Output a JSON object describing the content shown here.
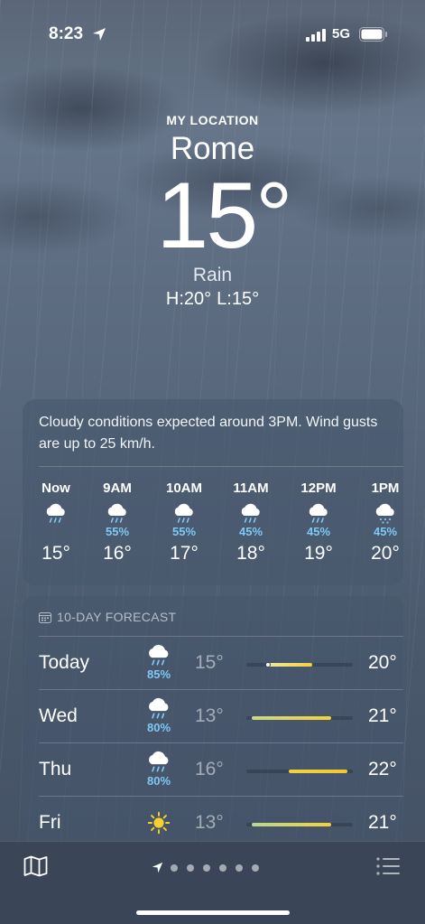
{
  "status_bar": {
    "time": "8:23",
    "network": "5G"
  },
  "header": {
    "location_label": "MY LOCATION",
    "city": "Rome",
    "temperature": "15°",
    "condition": "Rain",
    "high": "H:20°",
    "low": "L:15°"
  },
  "hourly": {
    "summary": "Cloudy conditions expected around 3PM. Wind gusts are up to 25 km/h.",
    "hours": [
      {
        "label": "Now",
        "icon": "cloud-rain-icon",
        "prob": "",
        "temp": "15°"
      },
      {
        "label": "9AM",
        "icon": "cloud-rain-icon",
        "prob": "55%",
        "temp": "16°"
      },
      {
        "label": "10AM",
        "icon": "cloud-rain-icon",
        "prob": "55%",
        "temp": "17°"
      },
      {
        "label": "11AM",
        "icon": "cloud-rain-icon",
        "prob": "45%",
        "temp": "18°"
      },
      {
        "label": "12PM",
        "icon": "cloud-rain-icon",
        "prob": "45%",
        "temp": "19°"
      },
      {
        "label": "1PM",
        "icon": "cloud-drizzle-icon",
        "prob": "45%",
        "temp": "20°"
      }
    ]
  },
  "ten_day": {
    "title": "10-DAY FORECAST",
    "days": [
      {
        "day": "Today",
        "icon": "cloud-rain-icon",
        "prob": "85%",
        "low": "15°",
        "high": "20°",
        "bar_start": 0.2,
        "bar_end": 0.62,
        "current": 0.2,
        "bar_color_from": "#e8eaa0",
        "bar_color_to": "#f2d23c"
      },
      {
        "day": "Wed",
        "icon": "cloud-rain-icon",
        "prob": "80%",
        "low": "13°",
        "high": "21°",
        "bar_start": 0.05,
        "bar_end": 0.8,
        "bar_color_from": "#c8d88a",
        "bar_color_to": "#f2d23c"
      },
      {
        "day": "Thu",
        "icon": "cloud-rain-icon",
        "prob": "80%",
        "low": "16°",
        "high": "22°",
        "bar_start": 0.4,
        "bar_end": 0.95,
        "bar_color_from": "#f2d23c",
        "bar_color_to": "#f2c830"
      },
      {
        "day": "Fri",
        "icon": "sun-icon",
        "prob": "",
        "low": "13°",
        "high": "21°",
        "bar_start": 0.05,
        "bar_end": 0.8,
        "bar_color_from": "#b8d890",
        "bar_color_to": "#f2d23c"
      }
    ]
  },
  "colors": {
    "precip": "#7ec8f4",
    "sun": "#f6d02c"
  },
  "bottom_bar": {
    "page_count": 6
  }
}
